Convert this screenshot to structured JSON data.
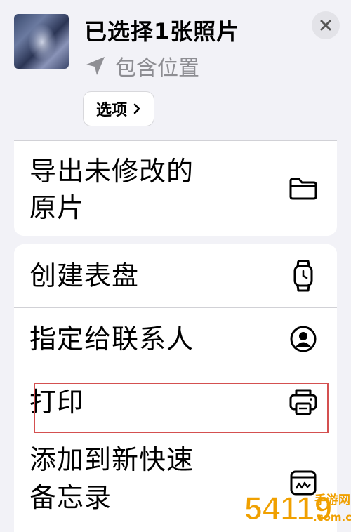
{
  "header": {
    "title": "已选择1张照片",
    "location": "包含位置",
    "options_label": "选项"
  },
  "menu": {
    "group1": [
      {
        "label_lines": [
          "导出未修改的",
          "原片"
        ],
        "icon": "folder-icon"
      }
    ],
    "group2": [
      {
        "label": "创建表盘",
        "icon": "watch-icon"
      },
      {
        "label": "指定给联系人",
        "icon": "contact-icon"
      },
      {
        "label": "打印",
        "icon": "printer-icon"
      },
      {
        "label_lines": [
          "添加到新快速",
          "备忘录"
        ],
        "icon": "quick-note-icon"
      }
    ]
  },
  "watermark": {
    "text": "54119",
    "site": "手游网",
    "domain": ".com.cn"
  },
  "colors": {
    "background": "#f2f2f7",
    "card": "#ffffff",
    "secondary_text": "#8e8e93",
    "highlight_border": "#d45050",
    "watermark": "#f0a000"
  }
}
